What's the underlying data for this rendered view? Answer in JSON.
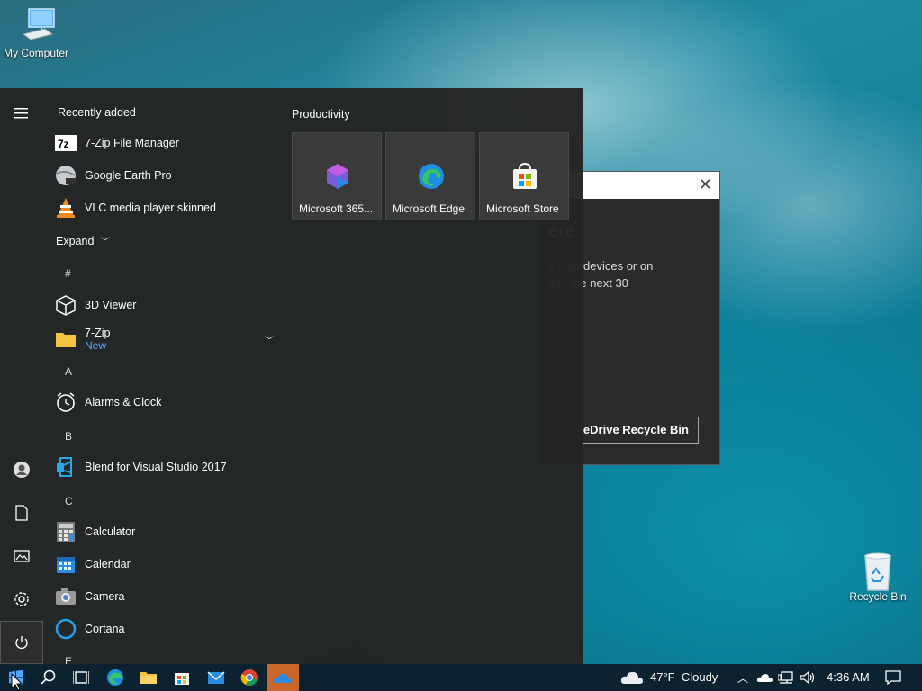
{
  "desktop": {
    "my_computer_label": "My Computer",
    "recycle_bin_label": "Recycle Bin"
  },
  "onedrive_dialog": {
    "heading": "ere",
    "body_line1": "s your devices or on",
    "body_line2": "thin the next 30",
    "button_label": "eDrive Recycle Bin"
  },
  "start_menu": {
    "recently_added_title": "Recently added",
    "recent_apps": [
      {
        "label": "7-Zip File Manager",
        "icon": "7zip-icon"
      },
      {
        "label": "Google Earth Pro",
        "icon": "google-earth-icon"
      },
      {
        "label": "VLC media player skinned",
        "icon": "vlc-icon"
      }
    ],
    "expand_label": "Expand",
    "letters": {
      "hash": "#",
      "a": "A",
      "b": "B",
      "c": "C",
      "e": "E"
    },
    "apps": {
      "viewer3d": "3D Viewer",
      "zip7": "7-Zip",
      "zip7_sub": "New",
      "alarms": "Alarms & Clock",
      "blend": "Blend for Visual Studio 2017",
      "calculator": "Calculator",
      "calendar": "Calendar",
      "camera": "Camera",
      "cortana": "Cortana"
    },
    "productivity_title": "Productivity",
    "tiles": [
      {
        "label": "Microsoft 365...",
        "icon": "microsoft-365-icon"
      },
      {
        "label": "Microsoft Edge",
        "icon": "edge-icon"
      },
      {
        "label": "Microsoft Store",
        "icon": "store-icon"
      }
    ]
  },
  "taskbar": {
    "weather_temp": "47°F",
    "weather_condition": "Cloudy",
    "time": "4:36 AM"
  },
  "colors": {
    "taskbar_bg": "#0d2230",
    "start_menu_bg": "#242424",
    "active_app_accent": "#c9672a",
    "new_label": "#5aa9ff"
  }
}
